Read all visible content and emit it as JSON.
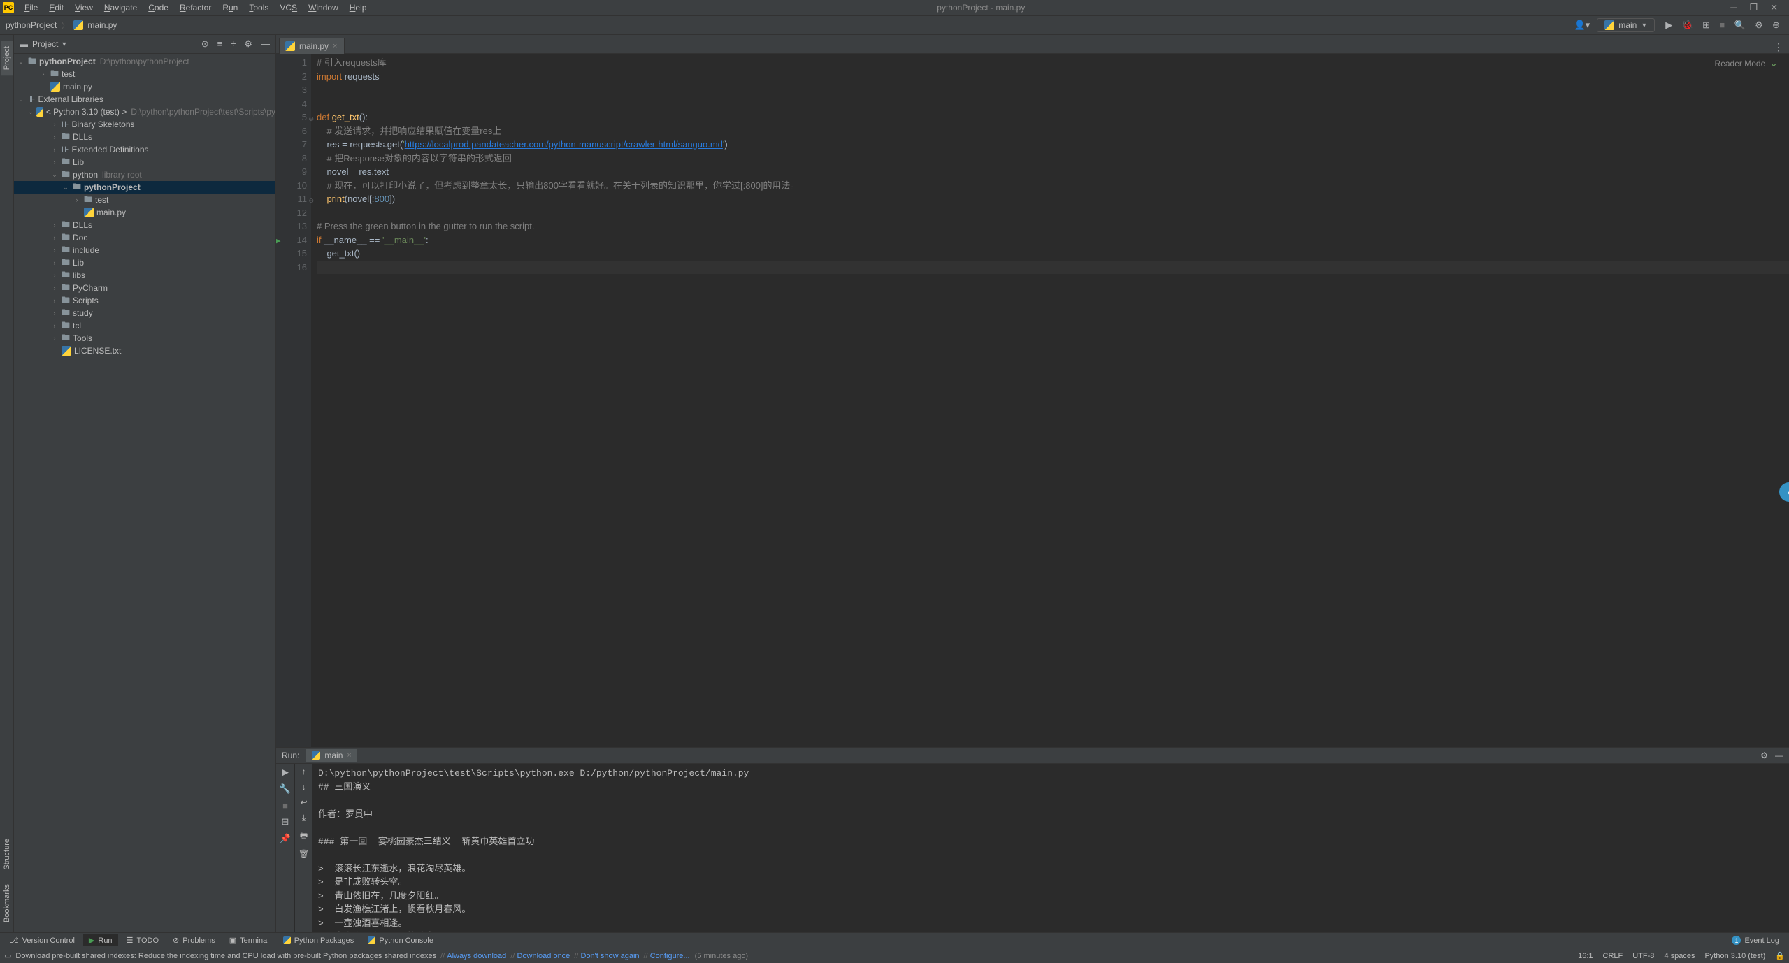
{
  "window": {
    "title": "pythonProject - main.py"
  },
  "menu": {
    "file": "File",
    "edit": "Edit",
    "view": "View",
    "navigate": "Navigate",
    "code": "Code",
    "refactor": "Refactor",
    "run": "Run",
    "tools": "Tools",
    "vcs": "VCS",
    "window": "Window",
    "help": "Help"
  },
  "breadcrumb": {
    "project": "pythonProject",
    "file": "main.py"
  },
  "run_config": {
    "name": "main"
  },
  "project_tool": {
    "title": "Project"
  },
  "tree": {
    "root": {
      "name": "pythonProject",
      "path": "D:\\python\\pythonProject"
    },
    "items": [
      {
        "indent": 1,
        "arrow": "›",
        "icon": "folder",
        "label": "test"
      },
      {
        "indent": 1,
        "arrow": "",
        "icon": "py",
        "label": "main.py"
      }
    ],
    "ext_lib": "External Libraries",
    "python_env": {
      "label": "< Python 3.10 (test) >",
      "path": "D:\\python\\pythonProject\\test\\Scripts\\py"
    },
    "env_items": [
      {
        "indent": 2,
        "arrow": "›",
        "icon": "lib",
        "label": "Binary Skeletons"
      },
      {
        "indent": 2,
        "arrow": "›",
        "icon": "folder",
        "label": "DLLs"
      },
      {
        "indent": 2,
        "arrow": "›",
        "icon": "lib",
        "label": "Extended Definitions"
      },
      {
        "indent": 2,
        "arrow": "›",
        "icon": "folder",
        "label": "Lib"
      },
      {
        "indent": 2,
        "arrow": "⌄",
        "icon": "folder",
        "label": "python",
        "suffix": "library root"
      },
      {
        "indent": 3,
        "arrow": "⌄",
        "icon": "folder",
        "label": "pythonProject",
        "bold": true,
        "selected": true
      },
      {
        "indent": 4,
        "arrow": "›",
        "icon": "folder",
        "label": "test"
      },
      {
        "indent": 4,
        "arrow": "",
        "icon": "py",
        "label": "main.py"
      },
      {
        "indent": 2,
        "arrow": "›",
        "icon": "folder",
        "label": "DLLs"
      },
      {
        "indent": 2,
        "arrow": "›",
        "icon": "folder",
        "label": "Doc"
      },
      {
        "indent": 2,
        "arrow": "›",
        "icon": "folder",
        "label": "include"
      },
      {
        "indent": 2,
        "arrow": "›",
        "icon": "folder",
        "label": "Lib"
      },
      {
        "indent": 2,
        "arrow": "›",
        "icon": "folder",
        "label": "libs"
      },
      {
        "indent": 2,
        "arrow": "›",
        "icon": "folder",
        "label": "PyCharm"
      },
      {
        "indent": 2,
        "arrow": "›",
        "icon": "folder",
        "label": "Scripts"
      },
      {
        "indent": 2,
        "arrow": "›",
        "icon": "folder",
        "label": "study"
      },
      {
        "indent": 2,
        "arrow": "›",
        "icon": "folder",
        "label": "tcl"
      },
      {
        "indent": 2,
        "arrow": "›",
        "icon": "folder",
        "label": "Tools"
      },
      {
        "indent": 2,
        "arrow": "",
        "icon": "py",
        "label": "LICENSE.txt"
      }
    ]
  },
  "editor": {
    "tab": "main.py",
    "reader_mode": "Reader Mode",
    "code_lines": 16,
    "url": "https://localprod.pandateacher.com/python-manuscript/crawler-html/sanguo.md",
    "comments": {
      "l1": "# 引入requests库",
      "l6": "# 发送请求，并把响应结果赋值在变量res上",
      "l8": "# 把Response对象的内容以字符串的形式返回",
      "l10": "# 现在，可以打印小说了，但考虑到整章太长，只输出800字看看就好。在关于列表的知识那里，你学过[:800]的用法。",
      "l13": "# Press the green button in the gutter to run the script."
    }
  },
  "run": {
    "label": "Run:",
    "tab": "main",
    "output_lines": [
      "D:\\python\\pythonProject\\test\\Scripts\\python.exe D:/python/pythonProject/main.py",
      "## 三国演义",
      "",
      "作者：罗贯中",
      "",
      "### 第一回  宴桃园豪杰三结义  斩黄巾英雄首立功",
      "",
      ">  滚滚长江东逝水，浪花淘尽英雄。",
      ">  是非成败转头空。",
      ">  青山依旧在，几度夕阳红。",
      ">  白发渔樵江渚上，惯看秋月春风。",
      ">  一壶浊酒喜相逢。",
      ">  古今多少事，都付笑谈中。"
    ]
  },
  "left_tabs": {
    "project": "Project",
    "structure": "Structure",
    "bookmarks": "Bookmarks"
  },
  "tool_tabs": {
    "vcs": "Version Control",
    "run": "Run",
    "todo": "TODO",
    "problems": "Problems",
    "terminal": "Terminal",
    "pypkg": "Python Packages",
    "pycon": "Python Console",
    "eventlog": "Event Log"
  },
  "status": {
    "msg_prefix": "Download pre-built shared indexes: Reduce the indexing time and CPU load with pre-built Python packages shared indexes",
    "link1": "Always download",
    "link2": "Download once",
    "link3": "Don't show again",
    "link4": "Configure...",
    "msg_suffix": "(5 minutes ago)",
    "pos": "16:1",
    "eol": "CRLF",
    "enc": "UTF-8",
    "indent": "4 spaces",
    "interp": "Python 3.10 (test)"
  }
}
